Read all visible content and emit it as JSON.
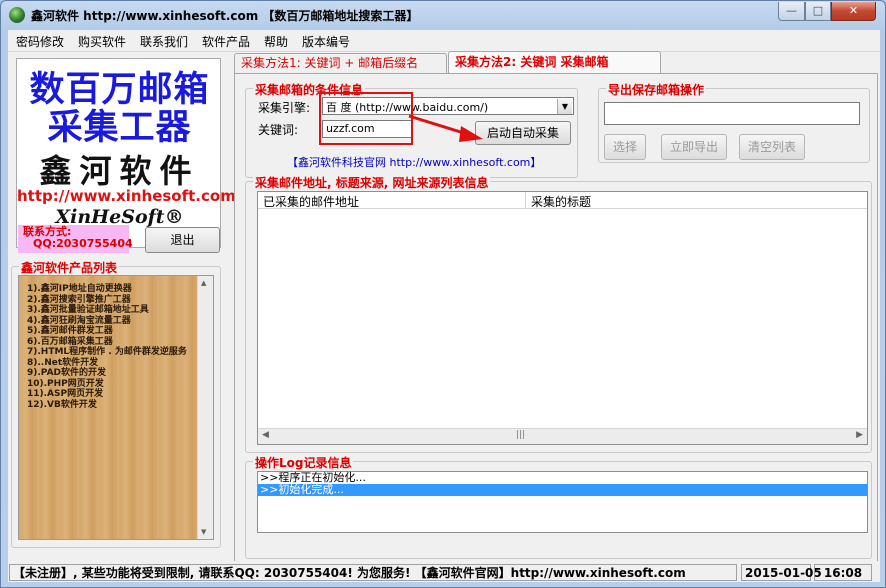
{
  "window": {
    "title": "鑫河软件 http://www.xinhesoft.com 【数百万邮箱地址搜索工器】",
    "min_glyph": "—",
    "max_glyph": "□",
    "close_glyph": "✕"
  },
  "menu": [
    "密码修改",
    "购买软件",
    "联系我们",
    "软件产品",
    "帮助",
    "版本编号"
  ],
  "logo": {
    "line1": "数百万邮箱",
    "line2": "采集工器",
    "line3": "鑫河软件",
    "url": "http://www.xinhesoft.com",
    "brand": "XinHeSoft®"
  },
  "contact": {
    "label": "联系方式:",
    "qq": "QQ:2030755404"
  },
  "exit_button": "退出",
  "products": {
    "title": "鑫河软件产品列表",
    "items": [
      "1).鑫河IP地址自动更换器",
      "2).鑫河搜索引擎推广工器",
      "3).鑫河批量验证邮箱地址工具",
      "4).鑫河狂刷淘宝流量工器",
      "5).鑫河邮件群发工器",
      "6).百万邮箱采集工器",
      "7).HTML程序制作 . 为邮件群发逆服务",
      "8)..Net软件开发",
      "9).PAD软件的开发",
      "10).PHP网页开发",
      "11).ASP网页开发",
      "12).VB软件开发"
    ]
  },
  "tabs": [
    {
      "label": "采集方法1: 关键词 + 邮箱后缀名",
      "active": false
    },
    {
      "label": "采集方法2: 关键词 采集邮箱",
      "active": true
    }
  ],
  "collect": {
    "group_title": "采集邮箱的条件信息",
    "engine_label": "采集引擎:",
    "engine_value": "百 度 (http://www.baidu.com/)",
    "keyword_label": "关键词:",
    "keyword_value": "uzzf.com",
    "start_button": "启动自动采集",
    "site_link": "【鑫河软件科技官网 http://www.xinhesoft.com】"
  },
  "export": {
    "group_title": "导出保存邮箱操作",
    "path_value": "",
    "buttons": [
      "选择",
      "立即导出",
      "清空列表"
    ]
  },
  "results": {
    "group_title": "采集邮件地址, 标题来源, 网址来源列表信息",
    "columns": [
      "已采集的邮件地址",
      "采集的标题"
    ]
  },
  "log": {
    "group_title": "操作Log记录信息",
    "lines": [
      ">>程序正在初始化...",
      ">>初始化完成..."
    ],
    "selected_index": 1
  },
  "status": {
    "notice": "【未注册】, 某些功能将受到限制, 请联系QQ: 2030755404! 为您服务! 【鑫河软件官网】http://www.xinhesoft.com",
    "date": "2015-01-05",
    "time": "16:08"
  },
  "colors": {
    "accent_red": "#e01010",
    "logo_blue": "#1a1adf",
    "contact_bg": "#f7b8f4",
    "selection_blue": "#3399ff"
  }
}
